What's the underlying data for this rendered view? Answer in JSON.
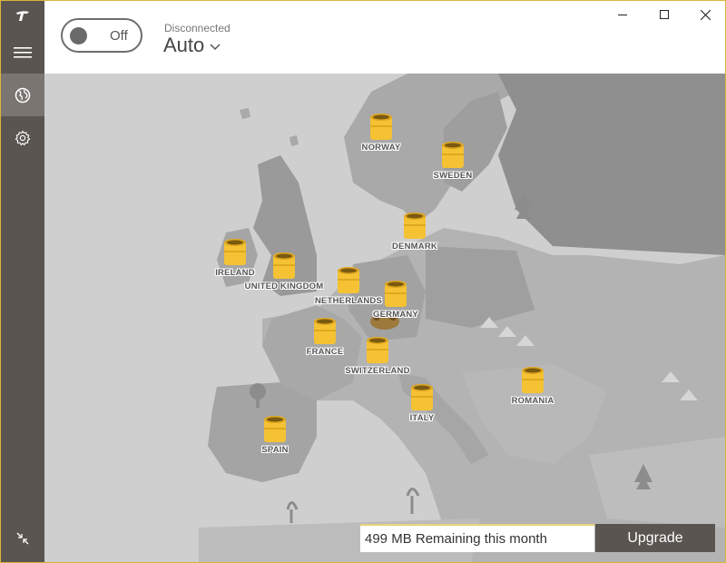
{
  "sidebar": {
    "logo_icon": "tunnelbear-logo-icon",
    "menu_icon": "hamburger-menu-icon",
    "globe_icon": "globe-icon",
    "settings_icon": "gear-icon",
    "collapse_icon": "collapse-arrows-icon"
  },
  "header": {
    "toggle_label": "Off",
    "status": "Disconnected",
    "location": "Auto"
  },
  "window_controls": {
    "minimize": "minimize-icon",
    "maximize": "maximize-icon",
    "close": "close-icon"
  },
  "map": {
    "countries": [
      {
        "name": "NORWAY"
      },
      {
        "name": "SWEDEN"
      },
      {
        "name": "DENMARK"
      },
      {
        "name": "IRELAND"
      },
      {
        "name": "UNITED KINGDOM"
      },
      {
        "name": "NETHERLANDS"
      },
      {
        "name": "GERMANY"
      },
      {
        "name": "FRANCE"
      },
      {
        "name": "SWITZERLAND"
      },
      {
        "name": "ITALY"
      },
      {
        "name": "ROMANIA"
      },
      {
        "name": "SPAIN"
      }
    ]
  },
  "footer": {
    "data_amount": "499 MB",
    "data_text": "Remaining this month",
    "upgrade_label": "Upgrade"
  },
  "colors": {
    "accent": "#f5c234",
    "sidebar": "#5a5550",
    "map": "#cfcfcf"
  }
}
